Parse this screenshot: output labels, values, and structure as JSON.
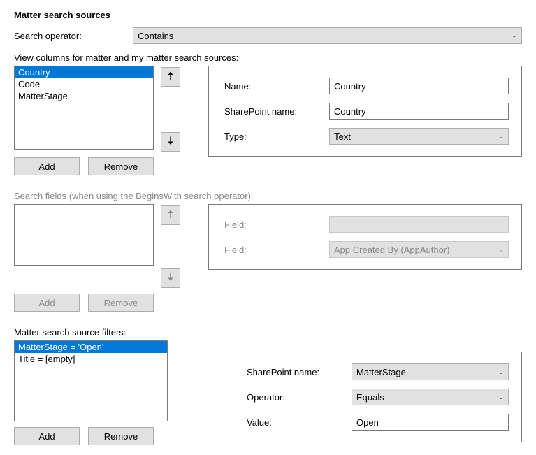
{
  "title": "Matter search sources",
  "searchOperator": {
    "label": "Search operator:",
    "value": "Contains"
  },
  "viewColumns": {
    "label": "View columns for matter and my matter search sources:",
    "items": [
      "Country",
      "Code",
      "MatterStage"
    ],
    "selectedIndex": 0,
    "addLabel": "Add",
    "removeLabel": "Remove",
    "details": {
      "nameLabel": "Name:",
      "nameValue": "Country",
      "spLabel": "SharePoint name:",
      "spValue": "Country",
      "typeLabel": "Type:",
      "typeValue": "Text"
    }
  },
  "searchFields": {
    "label": "Search fields (when using the BeginsWith search operator):",
    "items": [],
    "addLabel": "Add",
    "removeLabel": "Remove",
    "details": {
      "field1Label": "Field:",
      "field1Value": "",
      "field2Label": "Field:",
      "field2Value": "App Created By (AppAuthor)"
    }
  },
  "filters": {
    "label": "Matter search source filters:",
    "items": [
      "MatterStage = 'Open'",
      "Title = [empty]"
    ],
    "selectedIndex": 0,
    "addLabel": "Add",
    "removeLabel": "Remove",
    "details": {
      "spLabel": "SharePoint name:",
      "spValue": "MatterStage",
      "opLabel": "Operator:",
      "opValue": "Equals",
      "valLabel": "Value:",
      "valValue": "Open"
    }
  }
}
